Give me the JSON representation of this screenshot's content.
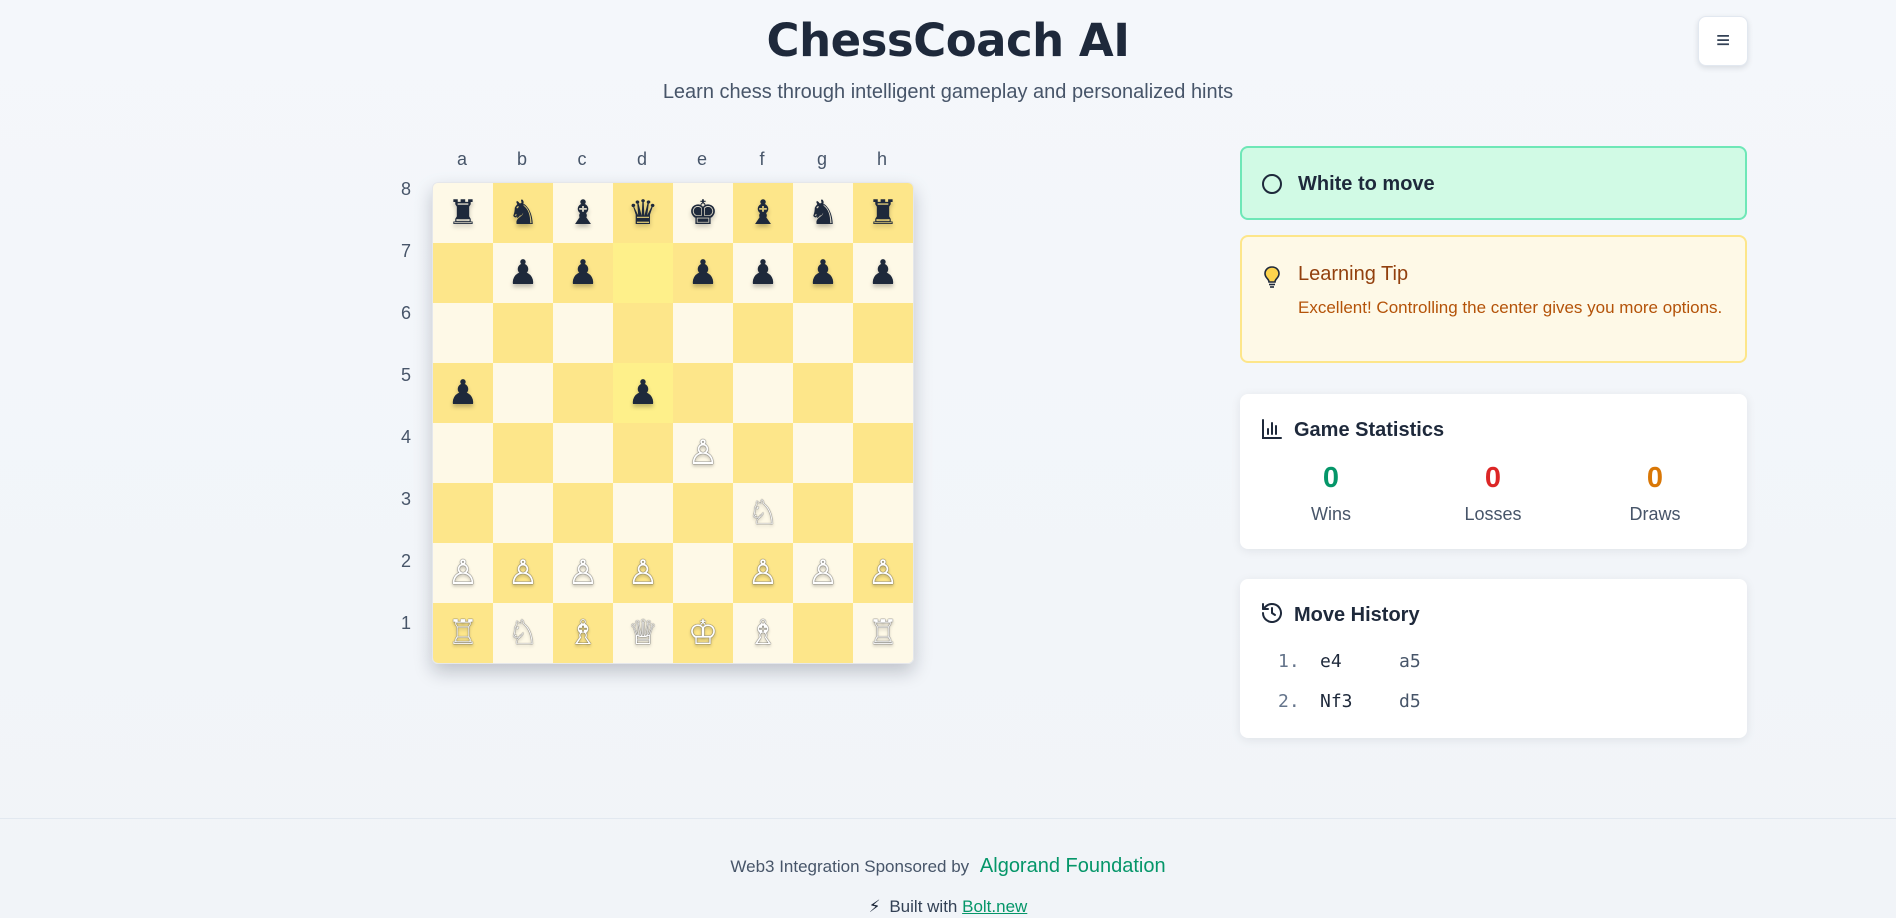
{
  "header": {
    "title": "ChessCoach AI",
    "subtitle": "Learn chess through intelligent gameplay and personalized hints",
    "menu_icon": "≡"
  },
  "board": {
    "files": [
      "a",
      "b",
      "c",
      "d",
      "e",
      "f",
      "g",
      "h"
    ],
    "ranks": [
      "8",
      "7",
      "6",
      "5",
      "4",
      "3",
      "2",
      "1"
    ],
    "rows": [
      [
        "♜",
        "♞",
        "♝",
        "♛",
        "♚",
        "♝",
        "♞",
        "♜"
      ],
      [
        "",
        "♟",
        "♟",
        "",
        "♟",
        "♟",
        "♟",
        "♟"
      ],
      [
        "",
        "",
        "",
        "",
        "",
        "",
        "",
        ""
      ],
      [
        "♟",
        "",
        "",
        "♟",
        "",
        "",
        "",
        ""
      ],
      [
        "",
        "",
        "",
        "",
        "♙",
        "",
        "",
        ""
      ],
      [
        "",
        "",
        "",
        "",
        "",
        "♘",
        "",
        ""
      ],
      [
        "♙",
        "♙",
        "♙",
        "♙",
        "",
        "♙",
        "♙",
        "♙"
      ],
      [
        "♖",
        "♘",
        "♗",
        "♕",
        "♔",
        "♗",
        "",
        "♖"
      ]
    ],
    "highlighted": [
      "d7",
      "d5"
    ]
  },
  "status": {
    "text": "White to move"
  },
  "tip": {
    "title": "Learning Tip",
    "text": "Excellent! Controlling the center gives you more options."
  },
  "stats": {
    "title": "Game Statistics",
    "wins": {
      "value": "0",
      "label": "Wins",
      "color": "#059669"
    },
    "losses": {
      "value": "0",
      "label": "Losses",
      "color": "#dc2626"
    },
    "draws": {
      "value": "0",
      "label": "Draws",
      "color": "#d97706"
    }
  },
  "history": {
    "title": "Move History",
    "moves": [
      {
        "num": "1.",
        "white": "e4",
        "black": "a5"
      },
      {
        "num": "2.",
        "white": "Nf3",
        "black": "d5"
      }
    ]
  },
  "footer": {
    "sponsor_text": "Web3 Integration Sponsored by",
    "sponsor_link": "Algorand Foundation",
    "built_text": "Built with",
    "built_link": "Bolt.new"
  }
}
